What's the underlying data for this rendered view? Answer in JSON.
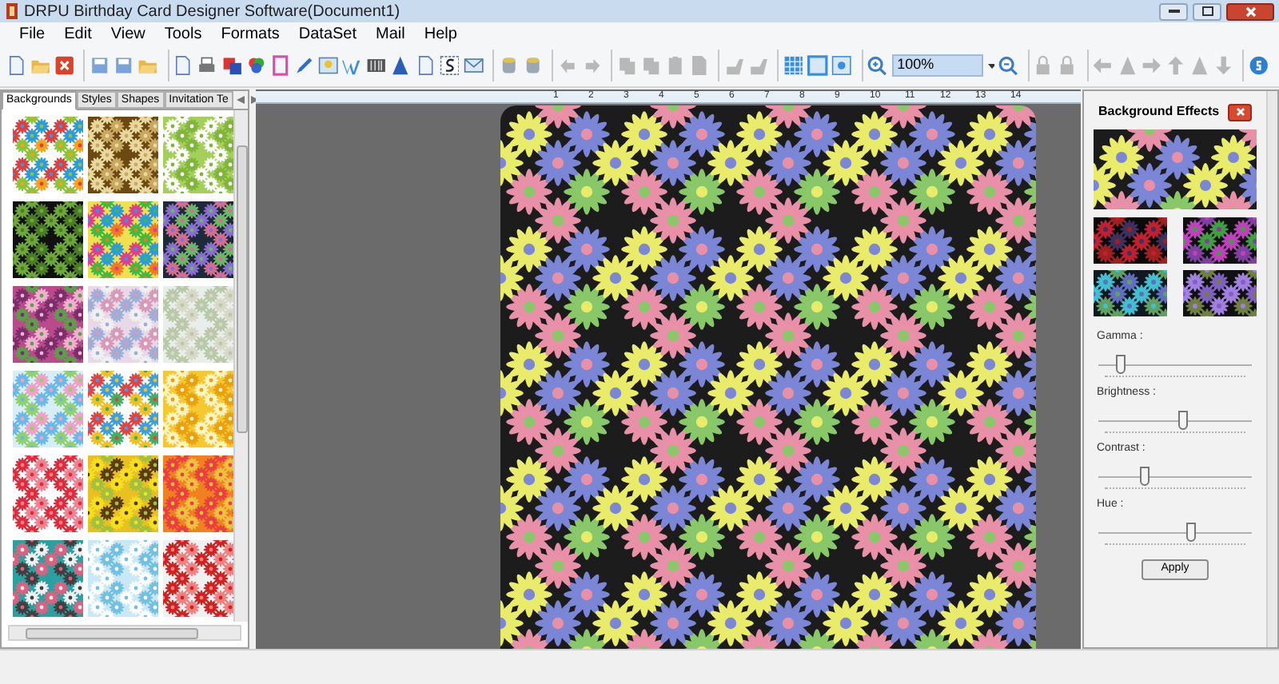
{
  "window": {
    "title": "DRPU Birthday Card Designer Software(Document1)"
  },
  "menu": [
    "File",
    "Edit",
    "View",
    "Tools",
    "Formats",
    "DataSet",
    "Mail",
    "Help"
  ],
  "toolbar": [
    {
      "disabled": false
    },
    {
      "disabled": false
    },
    {
      "disabled": false
    },
    {
      "disabled": false
    },
    {
      "disabled": false
    },
    {
      "disabled": false
    },
    {
      "disabled": false
    },
    {
      "disabled": false
    },
    {
      "disabled": false
    },
    {
      "disabled": false
    },
    {
      "disabled": false
    },
    {
      "disabled": false
    },
    {
      "disabled": false
    },
    {
      "disabled": false
    },
    {
      "disabled": false
    },
    {
      "disabled": false
    },
    {
      "disabled": false
    },
    {
      "disabled": false
    },
    {
      "disabled": false
    },
    {
      "disabled": false
    },
    {
      "disabled": false
    },
    {
      "disabled": true
    },
    {
      "disabled": true
    },
    {
      "disabled": true
    },
    {
      "disabled": true
    },
    {
      "disabled": true
    },
    {
      "disabled": true
    },
    {
      "disabled": true
    },
    {
      "disabled": true
    },
    {
      "disabled": false
    },
    {
      "disabled": false
    },
    {
      "disabled": false
    },
    {
      "disabled": false
    },
    {
      "disabled": false
    },
    {
      "disabled": true
    },
    {
      "disabled": true
    },
    {
      "disabled": true
    },
    {
      "disabled": true
    },
    {
      "disabled": true
    },
    {
      "disabled": true
    },
    {
      "disabled": true
    },
    {
      "disabled": true
    },
    {
      "disabled": false
    }
  ],
  "zoom": {
    "value": "100%"
  },
  "left_panel": {
    "tabs": [
      {
        "label": "Backgrounds",
        "selected": true
      },
      {
        "label": "Styles",
        "selected": false
      },
      {
        "label": "Shapes",
        "selected": false
      },
      {
        "label": "Invitation Te",
        "selected": false
      }
    ]
  },
  "ruler": {
    "labels": [
      "1",
      "2",
      "3",
      "4",
      "5",
      "6",
      "7",
      "8",
      "9",
      "10",
      "11",
      "12",
      "13",
      "14"
    ]
  },
  "effects_panel": {
    "title": "Background Effects",
    "sliders": [
      {
        "label": "Gamma :",
        "level": 0.15
      },
      {
        "label": "Brightness :",
        "level": 0.55
      },
      {
        "label": "Contrast :",
        "level": 0.3
      },
      {
        "label": "Hue :",
        "level": 0.6
      }
    ],
    "apply_button": "Apply"
  }
}
